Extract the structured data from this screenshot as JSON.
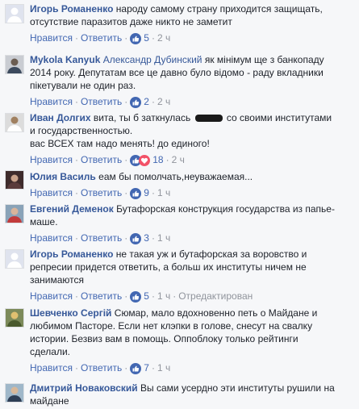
{
  "actions": {
    "like": "Нравится",
    "reply": "Ответить",
    "edited": "Отредактирован"
  },
  "separator": "·",
  "comments": [
    {
      "author": "Игорь Романенко",
      "text_lines": [
        "народу самому страну приходится защищать,",
        "отсутствие паразитов даже никто не заметит"
      ],
      "reactions": [
        "like"
      ],
      "count": "5",
      "time": "2 ч"
    },
    {
      "author": "Mykola Kanyuk",
      "mention": "Александр Дубинский",
      "text_lines": [
        " як мінімум ще з банкопаду",
        "2014 року. Депутатам все це давно було відомо - раду вкладники",
        "пікетували не один раз."
      ],
      "reactions": [
        "like"
      ],
      "count": "2",
      "time": "2 ч"
    },
    {
      "author": "Иван Долгих",
      "text_before": "вита, ты б заткнулась ",
      "text_after": " со своими институтами",
      "text_lines": [
        "и государственностью.",
        "вас ВСЕХ там надо менять! до единого!"
      ],
      "reactions": [
        "like",
        "love"
      ],
      "count": "18",
      "time": "2 ч"
    },
    {
      "author": "Юлия Василь",
      "text_lines": [
        "еам бы помолчать,неуважаемая..."
      ],
      "reactions": [
        "like"
      ],
      "count": "9",
      "time": "1 ч"
    },
    {
      "author": "Евгений Деменок",
      "text_lines": [
        "Бутафорская конструкция государства из папье-",
        "маше."
      ],
      "reactions": [
        "like"
      ],
      "count": "3",
      "time": "1 ч"
    },
    {
      "author": "Игорь Романенко",
      "text_lines": [
        "не такая уж и бутафорская за воровство и",
        "репресии придется ответить, а больш их институты ничем не",
        "занимаются"
      ],
      "reactions": [
        "like"
      ],
      "count": "5",
      "time": "1 ч",
      "edited": true
    },
    {
      "author": "Шевченко Сергій",
      "text_lines": [
        "Сюмар, мало вдохновенно петь о Майдане и",
        "любимом Пасторе. Если нет клэпки в голове, снесут на свалку",
        "истории. Безвиз вам в помощь. Оппоблоку только рейтинги",
        "сделали."
      ],
      "reactions": [
        "like"
      ],
      "count": "7",
      "time": "1 ч"
    },
    {
      "author": "Дмитрий Новаковский",
      "text_lines": [
        "Вы сами усердно эти институты рушили на",
        "майдане"
      ],
      "reactions": [],
      "count": "",
      "time": ""
    }
  ],
  "colors": {
    "link": "#365899",
    "action": "#4267b2",
    "meta": "#90949c",
    "like": "#4267b2",
    "love": "#f25268"
  }
}
